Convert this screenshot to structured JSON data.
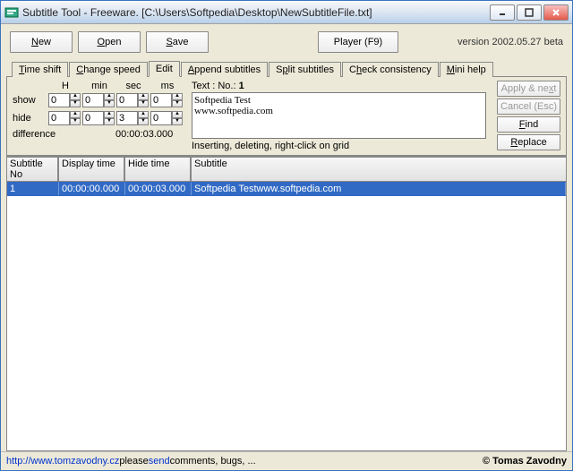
{
  "window": {
    "title": "Subtitle Tool - Freeware. [C:\\Users\\Softpedia\\Desktop\\NewSubtitleFile.txt]"
  },
  "toolbar": {
    "new": "New",
    "open": "Open",
    "save": "Save",
    "player": "Player (F9)",
    "version": "version  2002.05.27 beta"
  },
  "tabs": {
    "time_shift": "Time shift",
    "change_speed": "Change speed",
    "edit": "Edit",
    "append": "Append subtitles",
    "split": "Split subtitles",
    "check": "Check consistency",
    "help": "Mini help"
  },
  "edit": {
    "headers": {
      "h": "H",
      "min": "min",
      "sec": "sec",
      "ms": "ms"
    },
    "show_label": "show",
    "hide_label": "hide",
    "diff_label": "difference",
    "show": {
      "h": "0",
      "min": "0",
      "sec": "0",
      "ms": "0"
    },
    "hide": {
      "h": "0",
      "min": "0",
      "sec": "3",
      "ms": "0"
    },
    "difference": "00:00:03.000",
    "text_label": "Text :        No.:",
    "no_value": "1",
    "text_value": "Softpedia Test\nwww.softpedia.com",
    "hint": "Inserting, deleting, right-click on grid",
    "apply": "Apply & next",
    "cancel": "Cancel (Esc)",
    "find": "Find",
    "replace": "Replace"
  },
  "grid": {
    "headers": {
      "no": "Subtitle No",
      "disp": "Display time",
      "hide": "Hide time",
      "sub": "Subtitle"
    },
    "rows": [
      {
        "no": "1",
        "disp": "00:00:00.000",
        "hide": "00:00:03.000",
        "sub": "Softpedia Testwww.softpedia.com"
      }
    ]
  },
  "footer": {
    "url": "http://www.tomzavodny.cz",
    "mid1": "  please ",
    "send": "send",
    "mid2": " comments, bugs, ...",
    "copyright": "© Tomas Zavodny"
  }
}
